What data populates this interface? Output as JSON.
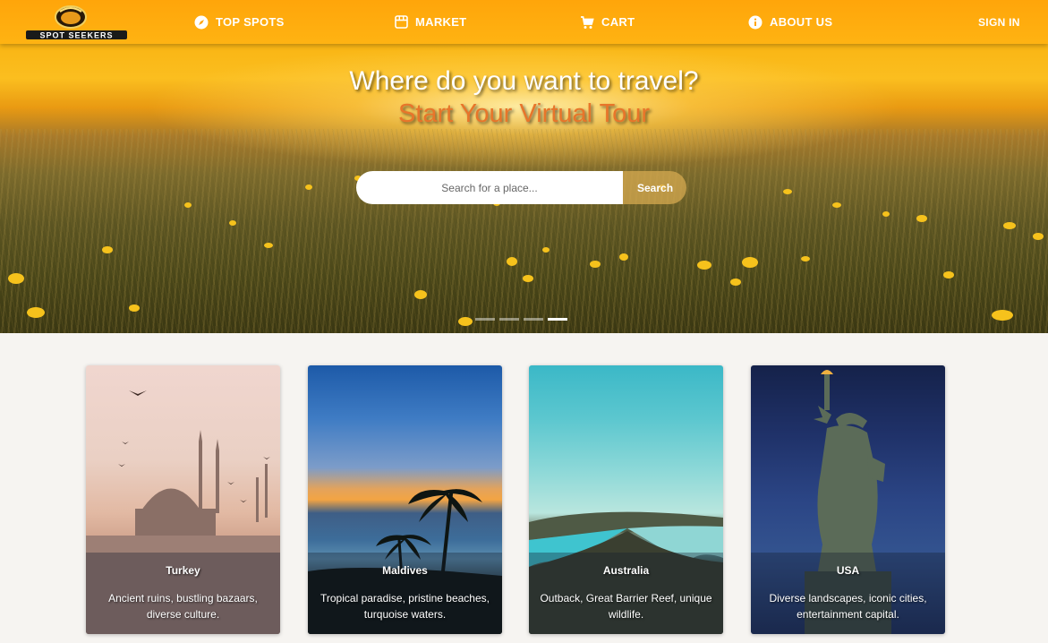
{
  "navbar": {
    "logo_text": "SPOT SEEKERS",
    "items": [
      {
        "label": "TOP SPOTS",
        "icon": "compass-icon"
      },
      {
        "label": "MARKET",
        "icon": "store-icon"
      },
      {
        "label": "CART",
        "icon": "cart-icon"
      },
      {
        "label": "ABOUT US",
        "icon": "info-icon"
      }
    ],
    "signin_label": "SIGN IN"
  },
  "hero": {
    "title": "Where do you want to travel?",
    "subtitle": "Start Your Virtual Tour",
    "search": {
      "placeholder": "Search for a place...",
      "value": "",
      "button_label": "Search"
    },
    "carousel": {
      "slide_count": 4,
      "active_slide": 4
    }
  },
  "cards": [
    {
      "title": "Turkey",
      "description": "Ancient ruins, bustling bazaars, diverse culture."
    },
    {
      "title": "Maldives",
      "description": "Tropical paradise, pristine beaches, turquoise waters."
    },
    {
      "title": "Australia",
      "description": "Outback, Great Barrier Reef, unique wildlife."
    },
    {
      "title": "USA",
      "description": "Diverse landscapes, iconic cities, entertainment capital."
    }
  ],
  "colors": {
    "navbar": "#ffa50a",
    "subtitle": "#e8752a",
    "page_background": "#f6f4f1"
  }
}
